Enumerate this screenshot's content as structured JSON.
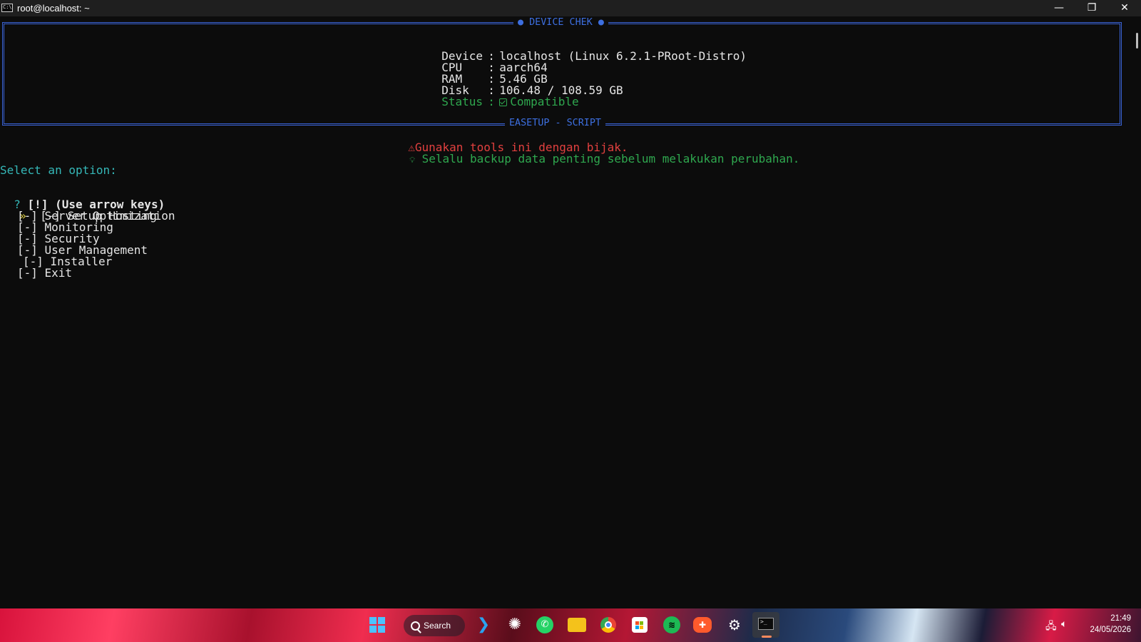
{
  "window": {
    "title": "root@localhost: ~",
    "icon_text": "C:\\",
    "minimize_icon": "minimize-icon",
    "restore_icon": "restore-icon",
    "close_icon": "close-icon"
  },
  "device_box": {
    "title": "● DEVICE CHEK ●",
    "rows": [
      {
        "label": "Device",
        "sep": ":",
        "value": "localhost (Linux 6.2.1-PRoot-Distro)"
      },
      {
        "label": "CPU",
        "sep": ":",
        "value": "aarch64"
      },
      {
        "label": "RAM",
        "sep": ":",
        "value": "5.46 GB"
      },
      {
        "label": "Disk",
        "sep": ":",
        "value": "106.48 / 108.59 GB"
      }
    ],
    "status": {
      "label": "Status",
      "sep": ":",
      "value": "Compatible"
    },
    "footer": "EASETUP - SCRIPT"
  },
  "notices": {
    "warning": "Gunakan tools ini dengan bijak.",
    "tip": "Selalu backup data penting sebelum melakukan perubahan."
  },
  "prompt": {
    "heading": "Select an option:",
    "question_mark": "?",
    "question": "[!] (Use arrow keys)",
    "pointer": "»",
    "options": [
      "[-] Setup Hosting",
      "[-] Server Optimization",
      "[-] Monitoring",
      "[-] Security",
      "[-] User Management",
      "[-] Installer",
      "[-] Exit"
    ],
    "selected_index": 0
  },
  "taskbar": {
    "search_label": "Search",
    "time": "21:49",
    "date": "24/05/2026",
    "apps": [
      "windows-start-icon",
      "vscode-icon",
      "chatgpt-icon",
      "whatsapp-icon",
      "file-explorer-icon",
      "chrome-icon",
      "microsoft-store-icon",
      "spotify-icon",
      "game-icon",
      "steam-icon",
      "terminal-icon"
    ]
  },
  "colors": {
    "background": "#0c0c0c",
    "border": "#3a63d6",
    "green": "#2fa84f",
    "red": "#e2403f",
    "cyan": "#35b8b8"
  }
}
